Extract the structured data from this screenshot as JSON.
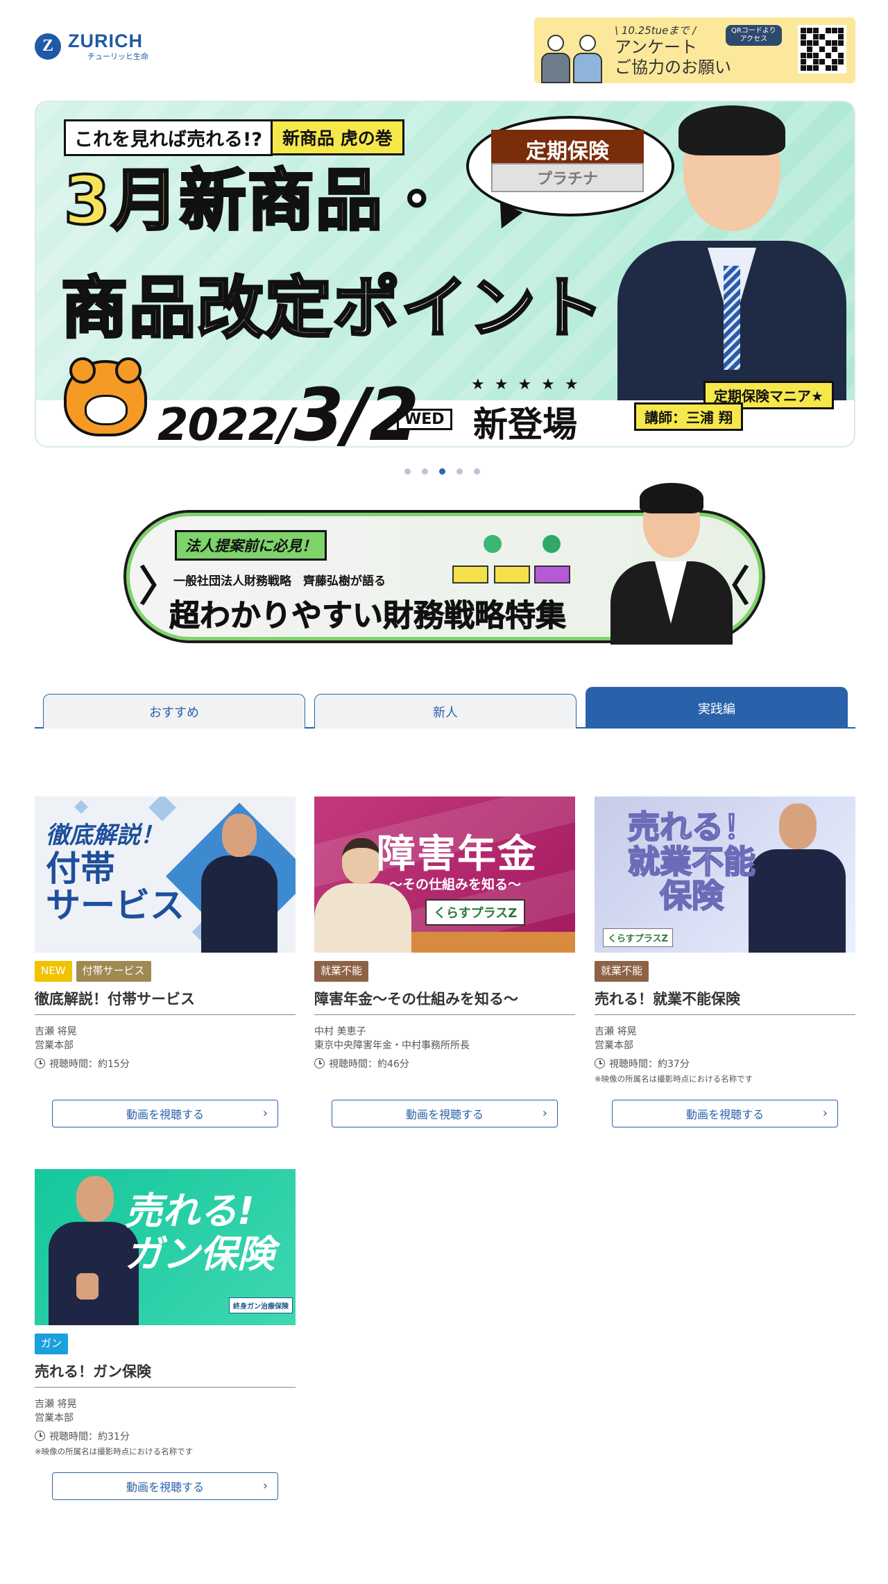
{
  "header": {
    "logo_text": "ZURICH",
    "logo_sub": "チューリッヒ生命",
    "logo_mark": "Z",
    "survey": {
      "date": "\\ 10.25tueまで /",
      "line1": "アンケート",
      "line2": "ご協力のお願い",
      "qr_label_1": "QRコードより",
      "qr_label_2": "アクセス"
    }
  },
  "hero": {
    "tag1": "これを見れば売れる!?",
    "tag2": "新商品 虎の巻",
    "title_month": "3月",
    "title_rest": "新商品・",
    "title_line2": "商品改定ポイント",
    "bubble_1": "定期保険",
    "bubble_2": "プラチナ",
    "date_prefix": "2022/",
    "date_big": "3/2",
    "weekday": "WED",
    "new_label": "新登場",
    "stars": "★★★★★",
    "mania": "定期保険マニア★",
    "teacher": "講師：三浦 翔"
  },
  "carousel": {
    "count": 5,
    "active_index": 2
  },
  "banner2": {
    "tag": "法人提案前に必見！",
    "sub": "一般社団法人財務戦略　齊藤弘樹が語る",
    "main": "超わかりやすい財務戦略特集",
    "arrow_left": "〉",
    "arrow_right": "〈"
  },
  "tabs": [
    {
      "label": "おすすめ",
      "active": false
    },
    {
      "label": "新人",
      "active": false
    },
    {
      "label": "実践編",
      "active": true
    }
  ],
  "cards": [
    {
      "thumb_line1": "徹底解説！",
      "thumb_line2": "付帯",
      "thumb_line3": "サービス",
      "badges": [
        {
          "text": "NEW",
          "color": "#f2c200"
        },
        {
          "text": "付帯サービス",
          "color": "#a08a52"
        }
      ],
      "title": "徹底解説！付帯サービス",
      "presenter": "吉瀬 将晃",
      "affiliation": "営業本部",
      "duration": "視聴時間：約15分",
      "note": "",
      "button": "動画を視聴する"
    },
    {
      "thumb_title": "障害年金",
      "thumb_sub": "～その仕組みを知る～",
      "thumb_logo": "くらすプラスZ",
      "badges": [
        {
          "text": "就業不能",
          "color": "#8e6247"
        }
      ],
      "title": "障害年金～その仕組みを知る～",
      "presenter": "中村 美恵子",
      "affiliation": "東京中央障害年金・中村事務所所長",
      "duration": "視聴時間：約46分",
      "note": "",
      "button": "動画を視聴する"
    },
    {
      "thumb_title_1": "売れる！",
      "thumb_title_2": "就業不能",
      "thumb_title_3": "保険",
      "thumb_logo": "くらすプラスZ",
      "badges": [
        {
          "text": "就業不能",
          "color": "#8e6247"
        }
      ],
      "title": "売れる！就業不能保険",
      "presenter": "吉瀬 将晃",
      "affiliation": "営業本部",
      "duration": "視聴時間：約37分",
      "note": "※映像の所属名は撮影時点における名称です",
      "button": "動画を視聴する"
    },
    {
      "thumb_title_1": "売れる!",
      "thumb_title_2": "ガン保険",
      "thumb_logo": "終身ガン治療保険",
      "badges": [
        {
          "text": "ガン",
          "color": "#1aa0dd"
        }
      ],
      "title": "売れる！ガン保険",
      "presenter": "吉瀬 将晃",
      "affiliation": "営業本部",
      "duration": "視聴時間：約31分",
      "note": "※映像の所属名は撮影時点における名称です",
      "button": "動画を視聴する"
    }
  ],
  "colors": {
    "brand": "#1f5aa6",
    "tab_active": "#2961aa",
    "hero_bg": "#bfeede"
  }
}
